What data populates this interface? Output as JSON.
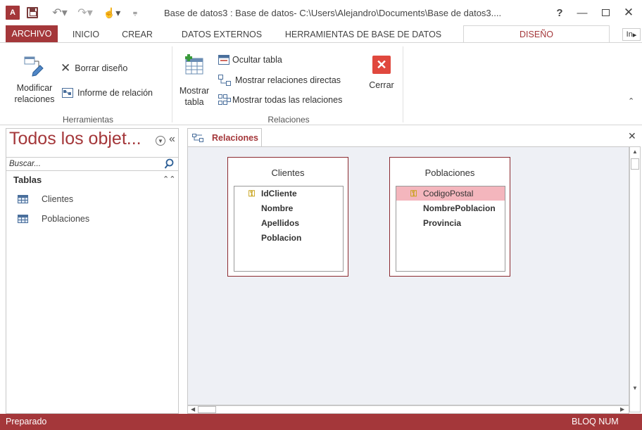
{
  "window": {
    "title": "Base de datos3 : Base de datos- C:\\Users\\Alejandro\\Documents\\Base de datos3....",
    "app_icon_text": "A",
    "help": "?",
    "minimize": "—",
    "close": "✕"
  },
  "ribbon_tabs": [
    {
      "label": "ARCHIVO"
    },
    {
      "label": "INICIO"
    },
    {
      "label": "CREAR"
    },
    {
      "label": "DATOS EXTERNOS"
    },
    {
      "label": "HERRAMIENTAS DE BASE DE DATOS"
    },
    {
      "label": "DISEÑO"
    },
    {
      "label": "In"
    }
  ],
  "ribbon": {
    "herramientas": {
      "label": "Herramientas",
      "modificar_line1": "Modificar",
      "modificar_line2": "relaciones",
      "borrar_diseno": "Borrar diseño",
      "informe_relacion": "Informe de relación"
    },
    "relaciones": {
      "label": "Relaciones",
      "mostrar_line1": "Mostrar",
      "mostrar_line2": "tabla",
      "ocultar_tabla": "Ocultar tabla",
      "mostrar_directas": "Mostrar relaciones directas",
      "mostrar_todas": "Mostrar todas las relaciones",
      "cerrar": "Cerrar"
    }
  },
  "nav": {
    "title": "Todos los objet...",
    "search_placeholder": "Buscar...",
    "group": "Tablas",
    "items": [
      {
        "label": "Clientes"
      },
      {
        "label": "Poblaciones"
      }
    ]
  },
  "document": {
    "tab_label": "Relaciones",
    "tables": [
      {
        "title": "Clientes",
        "fields": [
          "IdCliente",
          "Nombre",
          "Apellidos",
          "Poblacion"
        ],
        "key_field": "IdCliente"
      },
      {
        "title": "Poblaciones",
        "fields": [
          "CodigoPostal",
          "NombrePoblacion",
          "Provincia"
        ],
        "key_field": "CodigoPostal",
        "selected_field": "CodigoPostal"
      }
    ]
  },
  "status": {
    "left": "Preparado",
    "right": "BLOQ NUM"
  },
  "colors": {
    "accent": "#a4373a",
    "canvas": "#eef0f5",
    "selected_field": "#f4b6bd"
  }
}
